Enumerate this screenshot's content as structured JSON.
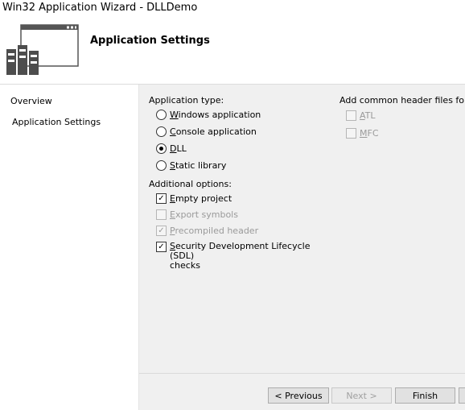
{
  "window": {
    "title": "Win32 Application Wizard - DLLDemo"
  },
  "header": {
    "heading": "Application Settings"
  },
  "nav": {
    "items": [
      {
        "label": "Overview"
      },
      {
        "label": "Application Settings"
      }
    ]
  },
  "app_type": {
    "label": "Application type:",
    "options": [
      {
        "label": "Windows application",
        "checked": false
      },
      {
        "label": "Console application",
        "checked": false
      },
      {
        "label": "DLL",
        "checked": true
      },
      {
        "label": "Static library",
        "checked": false
      }
    ]
  },
  "additional": {
    "label": "Additional options:",
    "options": [
      {
        "label": "Empty project",
        "checked": true,
        "enabled": true
      },
      {
        "label": "Export symbols",
        "checked": false,
        "enabled": false
      },
      {
        "label": "Precompiled header",
        "checked": true,
        "enabled": false
      },
      {
        "label": "Security Development Lifecycle (SDL)",
        "label2": "checks",
        "checked": true,
        "enabled": true
      }
    ]
  },
  "common_headers": {
    "label": "Add common header files for:",
    "options": [
      {
        "label": "ATL",
        "checked": false,
        "enabled": false
      },
      {
        "label": "MFC",
        "checked": false,
        "enabled": false
      }
    ]
  },
  "buttons": {
    "previous": "< Previous",
    "next": "Next >",
    "finish": "Finish"
  }
}
